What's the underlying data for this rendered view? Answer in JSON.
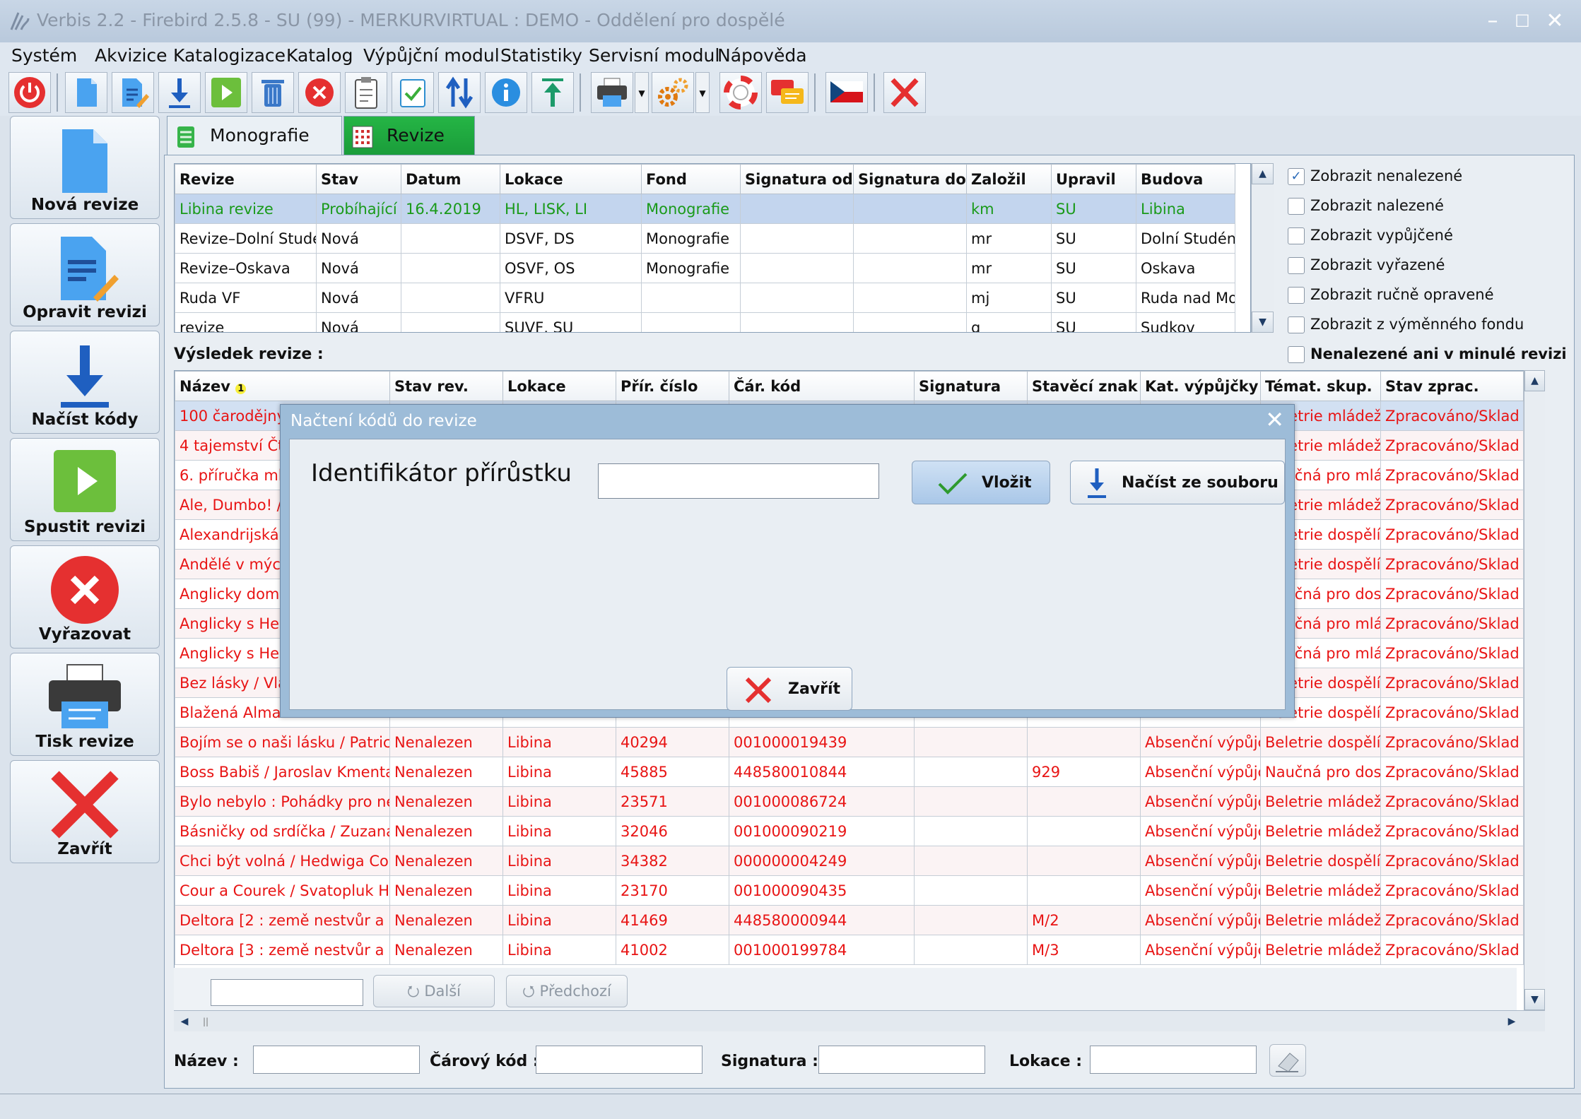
{
  "window": {
    "title": "Verbis 2.2 - Firebird 2.5.8 - SU (99) - MERKURVIRTUAL : DEMO - Oddělení pro dospělé"
  },
  "menu": [
    "Systém",
    "Akvizice",
    "Katalogizace",
    "Katalog",
    "Výpůjční modul",
    "Statistiky",
    "Servisní modul",
    "Nápověda"
  ],
  "sidebar": {
    "new": "Nová revize",
    "edit": "Opravit revizi",
    "load": "Načíst kódy",
    "run": "Spustit revizi",
    "discard": "Vyřazovat",
    "print": "Tisk revize",
    "close": "Zavřít"
  },
  "tabs": {
    "mono": "Monografie",
    "rev": "Revize"
  },
  "revisions": {
    "headers": [
      "Revize",
      "Stav",
      "Datum",
      "Lokace",
      "Fond",
      "Signatura od",
      "Signatura do",
      "Založil",
      "Upravil",
      "Budova"
    ],
    "rows": [
      [
        "Libina revize",
        "Probíhající",
        "16.4.2019",
        "HL, LISK, LI",
        "Monografie",
        "",
        "",
        "km",
        "SU",
        "Libina"
      ],
      [
        "Revize–Dolní Studén",
        "Nová",
        "",
        "DSVF, DS",
        "Monografie",
        "",
        "",
        "mr",
        "SU",
        "Dolní Studénk"
      ],
      [
        "Revize–Oskava",
        "Nová",
        "",
        "OSVF, OS",
        "Monografie",
        "",
        "",
        "mr",
        "SU",
        "Oskava"
      ],
      [
        "Ruda VF",
        "Nová",
        "",
        "VFRU",
        "",
        "",
        "",
        "mj",
        "SU",
        "Ruda nad Mor"
      ],
      [
        "revize",
        "Nová",
        "",
        "SUVF, SU",
        "",
        "",
        "",
        "g",
        "SU",
        "Sudkov"
      ]
    ]
  },
  "filters": {
    "show_not_found": "Zobrazit nenalezené",
    "show_found": "Zobrazit nalezené",
    "show_loaned": "Zobrazit vypůjčené",
    "show_discarded": "Zobrazit vyřazené",
    "show_manual": "Zobrazit ručně opravené",
    "show_exchange": "Zobrazit z výměnného fondu",
    "not_found_prev": "Nenalezené ani v minulé revizi"
  },
  "results": {
    "label": "Výsledek revize :",
    "headers": [
      "Název",
      "Stav rev.",
      "Lokace",
      "Přír. číslo",
      "Čár. kód",
      "Signatura",
      "Stavěcí znak",
      "Kat. výpůjčky",
      "Témat. skup.",
      "Stav zprac."
    ],
    "sort_badge": "1",
    "rows": [
      [
        "100 čarodějných",
        "",
        "",
        "",
        "",
        "",
        "",
        "",
        "Beletrie mládež",
        "Zpracováno/Sklad"
      ],
      [
        "4 tajemství Čty",
        "",
        "",
        "",
        "",
        "",
        "",
        "",
        "Beletrie mládež",
        "Zpracováno/Sklad"
      ],
      [
        "6. příručka mla",
        "",
        "",
        "",
        "",
        "",
        "",
        "",
        "Naučná pro mlád",
        "Zpracováno/Sklad"
      ],
      [
        "Ale, Dumbo! / [",
        "",
        "",
        "",
        "",
        "",
        "",
        "",
        "Beletrie mládež",
        "Zpracováno/Sklad"
      ],
      [
        "Alexandrijská k",
        "",
        "",
        "",
        "",
        "",
        "",
        "",
        "Beletrie dospělí",
        "Zpracováno/Sklad"
      ],
      [
        "Andělé v mých",
        "",
        "",
        "",
        "",
        "",
        "",
        "",
        "Beletrie dospělí",
        "Zpracováno/Sklad"
      ],
      [
        "Anglicky doma,",
        "",
        "",
        "",
        "",
        "",
        "",
        "",
        "Naučná pro dosp",
        "Zpracováno/Sklad"
      ],
      [
        "Anglicky s Hello",
        "",
        "",
        "",
        "",
        "",
        "",
        "",
        "Naučná pro mlád",
        "Zpracováno/Sklad"
      ],
      [
        "Anglicky s Hello",
        "",
        "",
        "",
        "",
        "",
        "",
        "",
        "Naučná pro mlád",
        "Zpracováno/Sklad"
      ],
      [
        "Bez lásky / Vlas",
        "",
        "",
        "",
        "",
        "",
        "",
        "",
        "Beletrie dospělí",
        "Zpracováno/Sklad"
      ],
      [
        "Blažená Alma M",
        "",
        "",
        "",
        "",
        "",
        "",
        "",
        "Beletrie dospělí",
        "Zpracováno/Sklad"
      ],
      [
        "Bojím se o naši lásku / Patricia",
        "Nenalezen",
        "Libina",
        "40294",
        "001000019439",
        "",
        "",
        "Absenční výpůjčka",
        "Beletrie dospělí",
        "Zpracováno/Sklad"
      ],
      [
        "Boss Babiš / Jaroslav Kmenta",
        "Nenalezen",
        "Libina",
        "45885",
        "448580010844",
        "",
        "929",
        "Absenční výpůjčka",
        "Naučná pro dosp",
        "Zpracováno/Sklad"
      ],
      [
        "Bylo nebylo : Pohádky pro nejmenší",
        "Nenalezen",
        "Libina",
        "23571",
        "001000086724",
        "",
        "",
        "Absenční výpůjčka",
        "Beletrie mládež",
        "Zpracováno/Sklad"
      ],
      [
        "Básničky od srdíčka / Zuzana K",
        "Nenalezen",
        "Libina",
        "32046",
        "001000090219",
        "",
        "",
        "Absenční výpůjčka",
        "Beletrie mládež",
        "Zpracováno/Sklad"
      ],
      [
        "Chci být volná / Hedwiga Cour",
        "Nenalezen",
        "Libina",
        "34382",
        "000000004249",
        "",
        "",
        "Absenční výpůjčka",
        "Beletrie dospělí",
        "Zpracováno/Sklad"
      ],
      [
        "Cour a Courek / Svatopluk Hrn",
        "Nenalezen",
        "Libina",
        "23170",
        "001000090435",
        "",
        "",
        "Absenční výpůjčka",
        "Beletrie mládež",
        "Zpracováno/Sklad"
      ],
      [
        "Deltora [2 : země nestvůr a kc",
        "Nenalezen",
        "Libina",
        "41469",
        "448580000944",
        "",
        "M/2",
        "Absenční výpůjčka",
        "Beletrie mládež",
        "Zpracováno/Sklad"
      ],
      [
        "Deltora [3 : země nestvůr a kc",
        "Nenalezen",
        "Libina",
        "41002",
        "001000199784",
        "",
        "M/3",
        "Absenční výpůjčka",
        "Beletrie mládež",
        "Zpracováno/Sklad"
      ]
    ]
  },
  "nav": {
    "next": "Další",
    "prev": "Předchozí"
  },
  "footer": {
    "name": "Název :",
    "barcode": "Čárový kód :",
    "signature": "Signatura :",
    "location": "Lokace :"
  },
  "dialog": {
    "title": "Načtení kódů do revize",
    "label": "Identifikátor přírůstku",
    "input_value": "",
    "insert": "Vložit",
    "load_file": "Načíst ze souboru",
    "close": "Zavřít"
  },
  "colors": {
    "accent_green": "#1a9c3a",
    "error_red": "#e81414",
    "selection": "#c3d5ee"
  }
}
